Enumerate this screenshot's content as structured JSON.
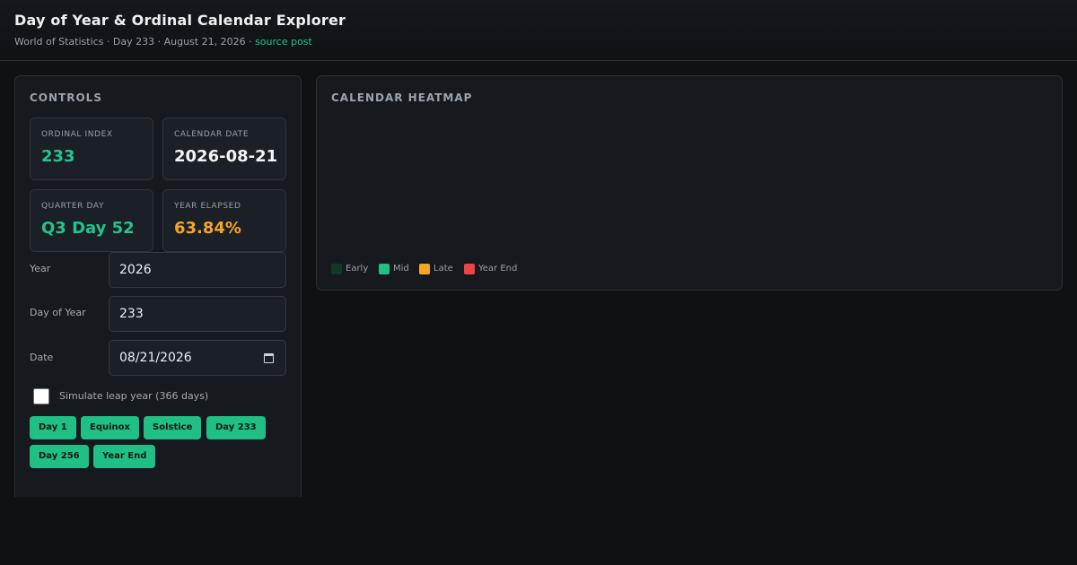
{
  "header": {
    "title": "Day of Year & Ordinal Calendar Explorer",
    "subtitle": "World of Statistics · Day 233 · August 21, 2026 · ",
    "source_link": "source post"
  },
  "controls": {
    "title": "CONTROLS",
    "stats": [
      {
        "label": "ORDINAL INDEX",
        "value": "233",
        "color": "#22c58c"
      },
      {
        "label": "CALENDAR DATE",
        "value": "2026-08-21",
        "color": "#f2f4f6"
      },
      {
        "label": "QUARTER DAY",
        "value": "Q3 Day 52",
        "color": "#22c58c"
      },
      {
        "label": "YEAR ELAPSED",
        "value": "63.84%",
        "color": "#f5a524"
      }
    ],
    "fields": {
      "year_label": "Year",
      "year_value": "2026",
      "day_label": "Day of Year",
      "day_value": "233",
      "date_label": "Date",
      "date_value": "08/21/2026"
    },
    "leap_label": "Simulate leap year (366 days)",
    "leap_checked": false,
    "presets": [
      "Day 1",
      "Equinox",
      "Solstice",
      "Day 233",
      "Day 256",
      "Year End"
    ]
  },
  "heatmap": {
    "title": "CALENDAR HEATMAP",
    "legend": [
      {
        "label": "Early",
        "color": "#123826"
      },
      {
        "label": "Mid",
        "color": "#1fbf85"
      },
      {
        "label": "Late",
        "color": "#f5a524"
      },
      {
        "label": "Year End",
        "color": "#ef4444"
      }
    ]
  }
}
